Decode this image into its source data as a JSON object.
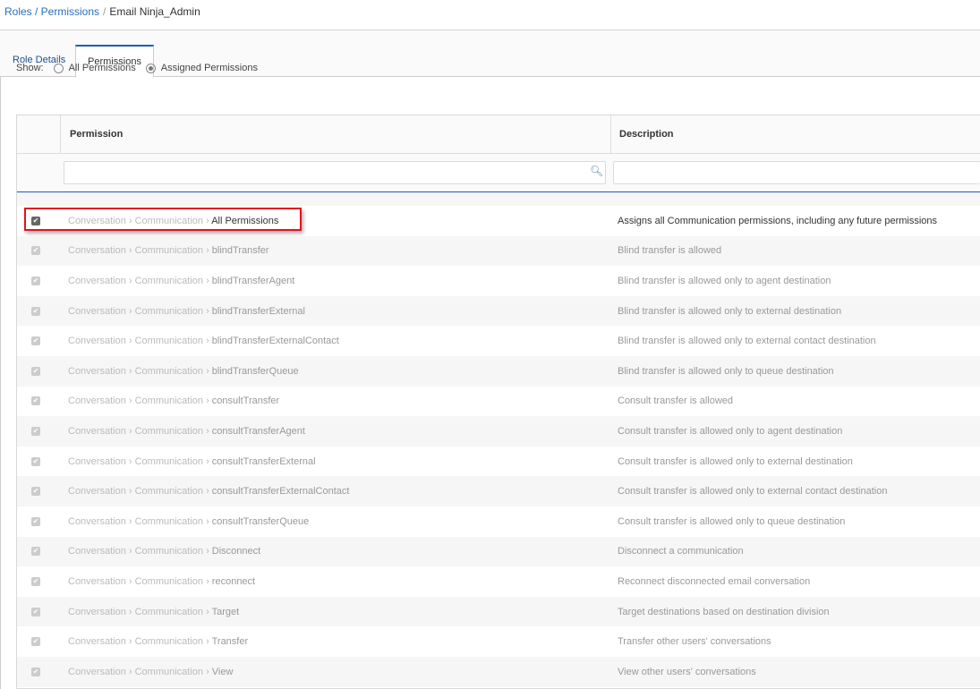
{
  "breadcrumb": {
    "link": "Roles / Permissions",
    "sep": "/",
    "current": "Email Ninja_Admin"
  },
  "tabs": [
    {
      "label": "Role Details"
    },
    {
      "label": "Permissions",
      "active": true
    }
  ],
  "show": {
    "label": "Show:",
    "options": [
      {
        "label": "All Permissions",
        "selected": false
      },
      {
        "label": "Assigned Permissions",
        "selected": true
      }
    ]
  },
  "table": {
    "headers": {
      "permission": "Permission",
      "description": "Description"
    },
    "filters": {
      "permission": "",
      "description": ""
    },
    "prefix": "Conversation › Communication ›",
    "rows": [
      {
        "leaf": "All Permissions",
        "description": "Assigns all Communication permissions, including any future permissions",
        "checked": true,
        "highlighted": true
      },
      {
        "leaf": "blindTransfer",
        "description": "Blind transfer is allowed",
        "checked": true
      },
      {
        "leaf": "blindTransferAgent",
        "description": "Blind transfer is allowed only to agent destination",
        "checked": true
      },
      {
        "leaf": "blindTransferExternal",
        "description": "Blind transfer is allowed only to external destination",
        "checked": true
      },
      {
        "leaf": "blindTransferExternalContact",
        "description": "Blind transfer is allowed only to external contact destination",
        "checked": true
      },
      {
        "leaf": "blindTransferQueue",
        "description": "Blind transfer is allowed only to queue destination",
        "checked": true
      },
      {
        "leaf": "consultTransfer",
        "description": "Consult transfer is allowed",
        "checked": true
      },
      {
        "leaf": "consultTransferAgent",
        "description": "Consult transfer is allowed only to agent destination",
        "checked": true
      },
      {
        "leaf": "consultTransferExternal",
        "description": "Consult transfer is allowed only to external destination",
        "checked": true
      },
      {
        "leaf": "consultTransferExternalContact",
        "description": "Consult transfer is allowed only to external contact destination",
        "checked": true
      },
      {
        "leaf": "consultTransferQueue",
        "description": "Consult transfer is allowed only to queue destination",
        "checked": true
      },
      {
        "leaf": "Disconnect",
        "description": "Disconnect a communication",
        "checked": true
      },
      {
        "leaf": "reconnect",
        "description": "Reconnect disconnected email conversation",
        "checked": true
      },
      {
        "leaf": "Target",
        "description": "Target destinations based on destination division",
        "checked": true
      },
      {
        "leaf": "Transfer",
        "description": "Transfer other users' conversations",
        "checked": true
      },
      {
        "leaf": "View",
        "description": "View other users' conversations",
        "checked": true
      }
    ]
  }
}
